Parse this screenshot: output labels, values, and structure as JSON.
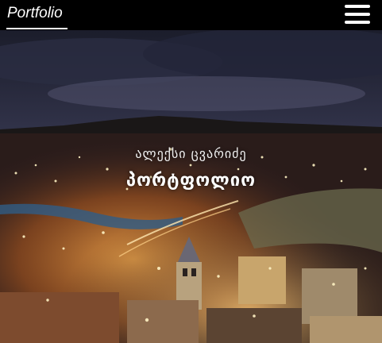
{
  "navbar": {
    "brand": "Portfolio",
    "menu_icon": "hamburger-icon"
  },
  "hero": {
    "subtitle": "ალექსი ცვარიძე",
    "title": "პორტფოლიო",
    "background": "night city panorama"
  },
  "colors": {
    "navbar_bg": "#000000",
    "text": "#ffffff",
    "sky_top": "#1a1c2e",
    "lights": "#f6b85a"
  }
}
